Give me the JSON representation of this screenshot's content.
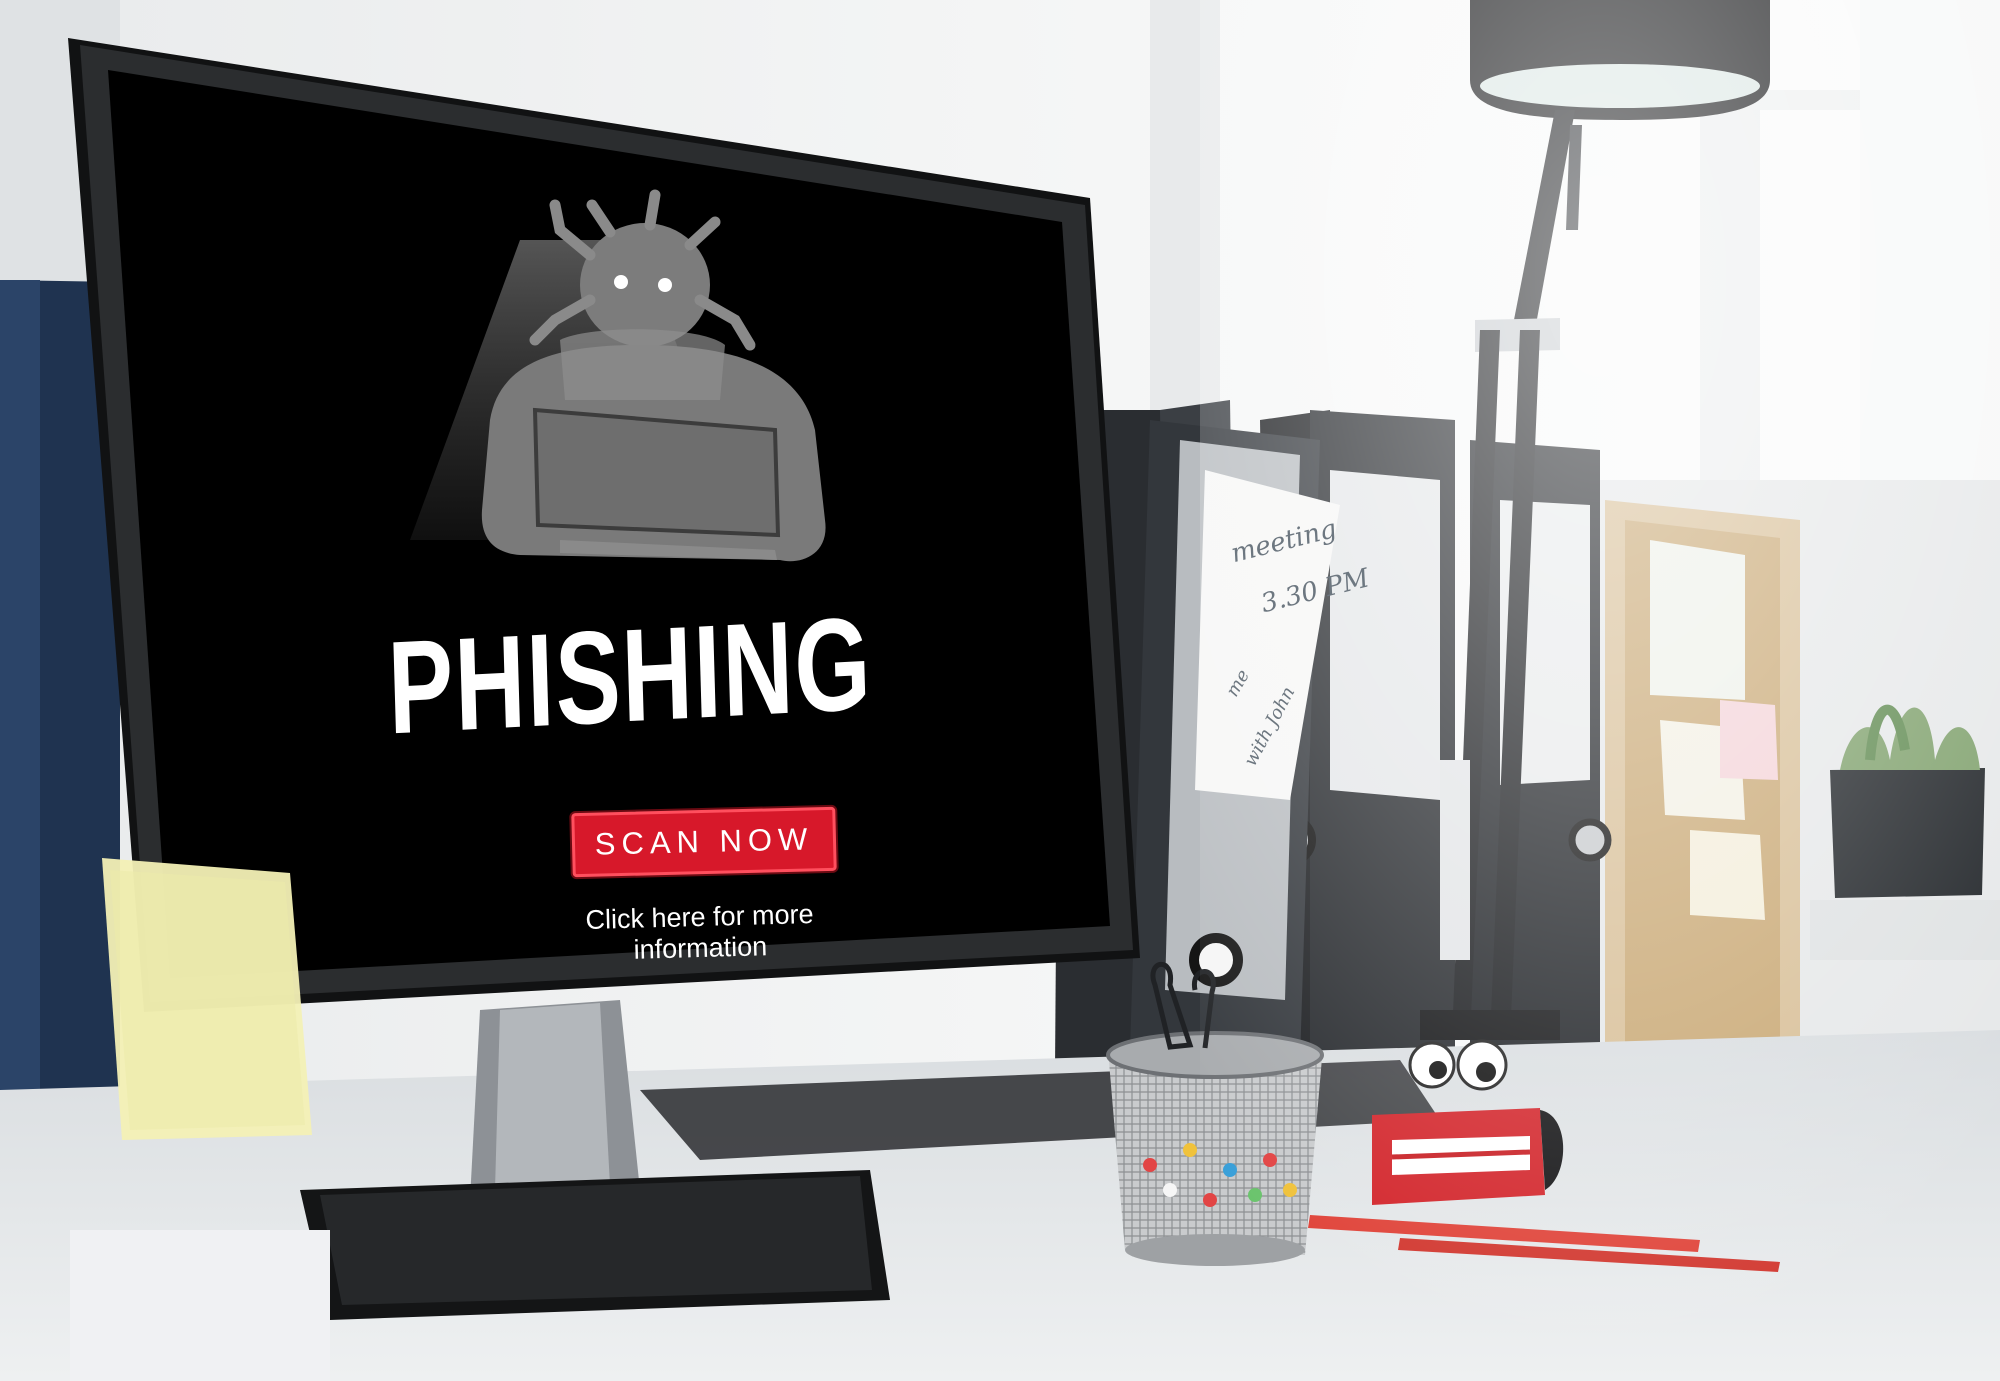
{
  "screen": {
    "headline": "PHISHING",
    "scan_button_label": "SCAN NOW",
    "info_link_text": "Click here for more information",
    "icon": "hacker-bug-icon"
  },
  "sticky_note": {
    "lines": [
      "meeting",
      "3.30 PM",
      "me",
      "with John"
    ]
  },
  "colors": {
    "screen_background": "#000000",
    "button_red": "#d7182a",
    "text_white": "#ffffff"
  }
}
